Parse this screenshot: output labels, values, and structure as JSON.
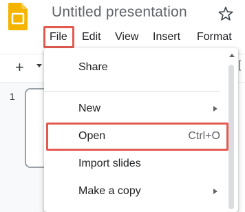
{
  "app": {
    "title": "Untitled presentation",
    "icon": "google-slides-icon",
    "star_icon": "star-icon",
    "colors": {
      "logo": "#f4b400",
      "highlight": "#e35a50"
    }
  },
  "menubar": {
    "items": [
      "File",
      "Edit",
      "View",
      "Insert",
      "Format"
    ]
  },
  "toolbar": {
    "add_label": "+"
  },
  "filmstrip": {
    "slide_number": "1"
  },
  "file_menu": {
    "items": [
      {
        "label": "Share",
        "shortcut": ""
      },
      {
        "label": "New",
        "shortcut": ""
      },
      {
        "label": "Open",
        "shortcut": "Ctrl+O"
      },
      {
        "label": "Import slides",
        "shortcut": ""
      },
      {
        "label": "Make a copy",
        "shortcut": ""
      }
    ]
  }
}
